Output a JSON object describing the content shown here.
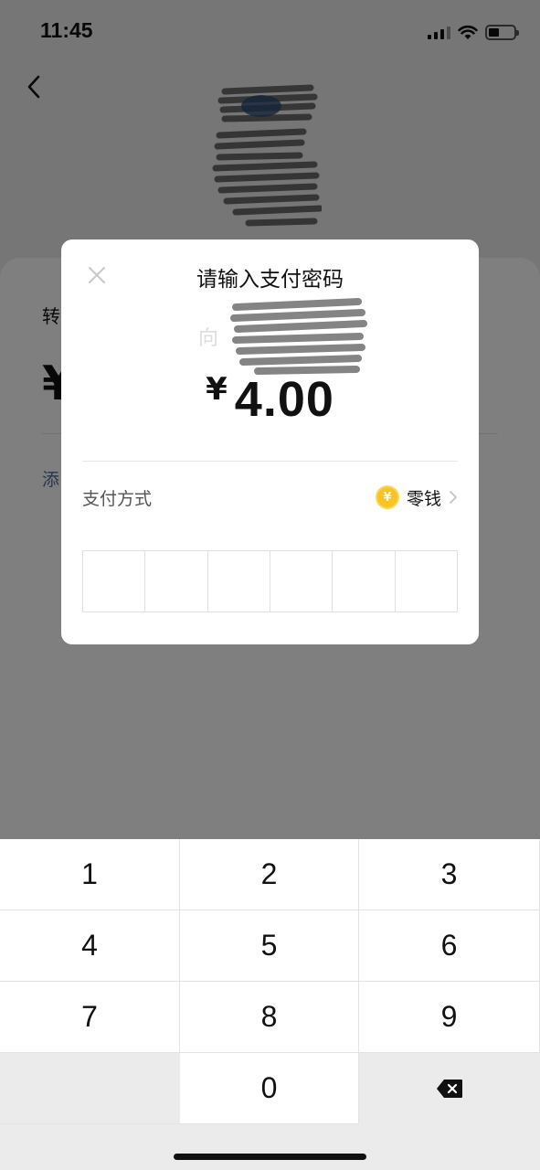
{
  "status_bar": {
    "time": "11:45"
  },
  "background": {
    "transfer_label": "转",
    "currency_symbol": "¥",
    "add_note_label": "添"
  },
  "dialog": {
    "title": "请输入支付密码",
    "recipient_prefix": "向",
    "amount_currency": "¥",
    "amount": "4.00",
    "payment_method_label": "支付方式",
    "payment_method_value": "零钱",
    "coin_symbol": "¥",
    "pin_length": 6
  },
  "keypad": {
    "keys": [
      "1",
      "2",
      "3",
      "4",
      "5",
      "6",
      "7",
      "8",
      "9",
      "0"
    ]
  },
  "icons": {
    "back": "chevron-left-icon",
    "close": "close-icon",
    "payment": "coin-icon",
    "chevron": "chevron-right-icon",
    "delete": "backspace-icon"
  },
  "colors": {
    "overlay": "#000000",
    "coin": "#f7c325",
    "link": "#576b95"
  }
}
